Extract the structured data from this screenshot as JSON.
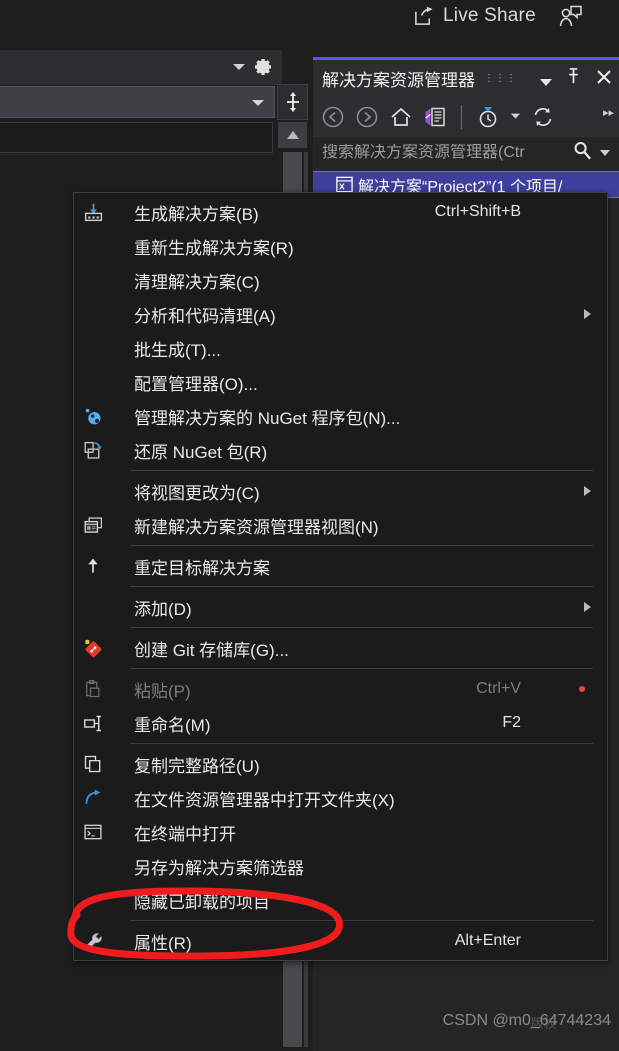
{
  "topbar": {
    "live_share_label": "Live Share",
    "share_icon": "share-arrow-icon",
    "people_icon": "people-share-icon"
  },
  "left_pane": {
    "gear_icon": "gear-icon",
    "dropdown_caret_icon": "chevron-down-icon",
    "splitter_icon": "horizontal-split-icon",
    "scroll_up_icon": "scroll-up-arrow-icon",
    "combo_value": ""
  },
  "solution_explorer": {
    "title": "解决方案资源管理器",
    "drag_dots": "⋮⋮⋮",
    "window_menu_icon": "chevron-down-icon",
    "pin_icon": "pin-icon",
    "close_icon": "close-icon",
    "toolbar": [
      {
        "name": "back-icon",
        "glyph": "←"
      },
      {
        "name": "forward-icon",
        "glyph": "→"
      },
      {
        "name": "home-icon",
        "glyph": "⌂"
      },
      {
        "name": "solution-view-icon",
        "glyph": "▤"
      },
      {
        "name": "pending-changes-filter-icon",
        "glyph": "◷"
      },
      {
        "name": "filter-dropdown-icon",
        "glyph": "▾"
      },
      {
        "name": "refresh-icon",
        "glyph": "⟳"
      }
    ],
    "overflow_label": "▸▸",
    "search_placeholder": "搜索解决方案资源管理器(Ctr",
    "search_value": "",
    "search_icon": "search-icon",
    "search_dropdown_icon": "chevron-down-icon",
    "tree": {
      "selected_row": {
        "icon": "solution-icon",
        "label": "解决方案“Proiect2”(1 个项目/"
      }
    }
  },
  "context_menu": {
    "items": [
      {
        "id": "build-solution",
        "icon": "build-icon",
        "label": "生成解决方案(B)",
        "accel": "Ctrl+Shift+B",
        "submenu": false,
        "disabled": false,
        "sep_after": false
      },
      {
        "id": "rebuild-solution",
        "icon": "",
        "label": "重新生成解决方案(R)",
        "accel": "",
        "submenu": false,
        "disabled": false,
        "sep_after": false
      },
      {
        "id": "clean-solution",
        "icon": "",
        "label": "清理解决方案(C)",
        "accel": "",
        "submenu": false,
        "disabled": false,
        "sep_after": false
      },
      {
        "id": "analyze-cleanup",
        "icon": "",
        "label": "分析和代码清理(A)",
        "accel": "",
        "submenu": true,
        "disabled": false,
        "sep_after": false
      },
      {
        "id": "batch-build",
        "icon": "",
        "label": "批生成(T)...",
        "accel": "",
        "submenu": false,
        "disabled": false,
        "sep_after": false
      },
      {
        "id": "configuration-mgr",
        "icon": "",
        "label": "配置管理器(O)...",
        "accel": "",
        "submenu": false,
        "disabled": false,
        "sep_after": false
      },
      {
        "id": "manage-nuget",
        "icon": "nuget-icon",
        "label": "管理解决方案的 NuGet 程序包(N)...",
        "accel": "",
        "submenu": false,
        "disabled": false,
        "sep_after": false
      },
      {
        "id": "restore-nuget",
        "icon": "restore-nuget-icon",
        "label": "还原 NuGet 包(R)",
        "accel": "",
        "submenu": false,
        "disabled": false,
        "sep_after": true
      },
      {
        "id": "change-view-to",
        "icon": "",
        "label": "将视图更改为(C)",
        "accel": "",
        "submenu": true,
        "disabled": false,
        "sep_after": false
      },
      {
        "id": "new-sol-exp-view",
        "icon": "new-window-icon",
        "label": "新建解决方案资源管理器视图(N)",
        "accel": "",
        "submenu": false,
        "disabled": false,
        "sep_after": true
      },
      {
        "id": "retarget-solution",
        "icon": "up-arrow-icon",
        "label": "重定目标解决方案",
        "accel": "",
        "submenu": false,
        "disabled": false,
        "sep_after": true
      },
      {
        "id": "add",
        "icon": "",
        "label": "添加(D)",
        "accel": "",
        "submenu": true,
        "disabled": false,
        "sep_after": true
      },
      {
        "id": "create-git-repo",
        "icon": "git-icon",
        "label": "创建 Git 存储库(G)...",
        "accel": "",
        "submenu": false,
        "disabled": false,
        "sep_after": true
      },
      {
        "id": "paste",
        "icon": "paste-icon",
        "label": "粘贴(P)",
        "accel": "Ctrl+V",
        "submenu": false,
        "disabled": true,
        "sep_after": false,
        "reddot": true
      },
      {
        "id": "rename",
        "icon": "rename-icon",
        "label": "重命名(M)",
        "accel": "F2",
        "submenu": false,
        "disabled": false,
        "sep_after": true
      },
      {
        "id": "copy-full-path",
        "icon": "copy-icon",
        "label": "复制完整路径(U)",
        "accel": "",
        "submenu": false,
        "disabled": false,
        "sep_after": false
      },
      {
        "id": "open-folder-explorer",
        "icon": "open-folder-arrow-icon",
        "label": "在文件资源管理器中打开文件夹(X)",
        "accel": "",
        "submenu": false,
        "disabled": false,
        "sep_after": false
      },
      {
        "id": "open-in-terminal",
        "icon": "terminal-icon",
        "label": "在终端中打开",
        "accel": "",
        "submenu": false,
        "disabled": false,
        "sep_after": false
      },
      {
        "id": "save-as-solution-filter",
        "icon": "",
        "label": "另存为解决方案筛选器",
        "accel": "",
        "submenu": false,
        "disabled": false,
        "sep_after": false
      },
      {
        "id": "hide-unloaded",
        "icon": "",
        "label": "隐藏已卸载的项目",
        "accel": "",
        "submenu": false,
        "disabled": false,
        "sep_after": true
      },
      {
        "id": "properties",
        "icon": "wrench-icon",
        "label": "属性(R)",
        "accel": "Alt+Enter",
        "submenu": false,
        "disabled": false,
        "sep_after": false
      }
    ]
  },
  "annotation": {
    "shape": "hand-drawn-ellipse",
    "color": "#ee1c1c",
    "targets": "properties"
  },
  "watermark": {
    "text": "CSDN @m0_64744234",
    "ghost": "版权"
  },
  "colors": {
    "background": "#1e1e1e",
    "menu_background": "#1b1b1c",
    "panel_background": "#252526",
    "titlebar": "#2d2d30",
    "accent_purple": "#5b5bd6",
    "selection": "#3f3f9e",
    "annotation_red": "#ee1c1c"
  }
}
